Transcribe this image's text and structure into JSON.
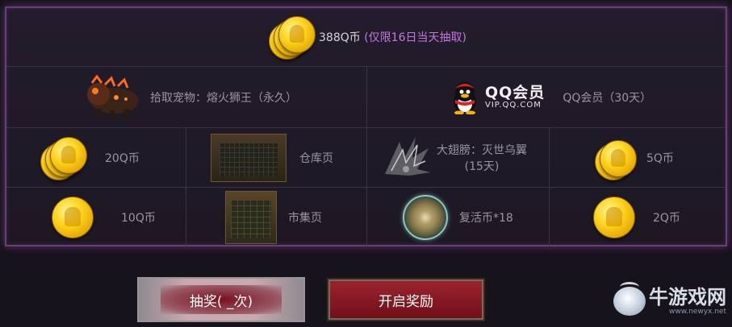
{
  "header": {
    "amount_text": "388Q币",
    "note_text": "(仅限16日当天抽取)"
  },
  "rewards": {
    "row1": [
      {
        "icon": "lion-pet-icon",
        "label": "拾取宠物：熔火狮王（永久）"
      },
      {
        "icon": "qq-vip-logo",
        "logo_title": "QQ会员",
        "logo_sub": "VIP.QQ.COM",
        "label": "QQ会员（30天）"
      }
    ],
    "row2": [
      {
        "icon": "coin-stack-icon",
        "label": "20Q币"
      },
      {
        "icon": "warehouse-page-icon",
        "label": "仓库页"
      },
      {
        "icon": "wings-icon",
        "label_line1": "大翅膀：灭世乌翼",
        "label_line2": "(15天)"
      },
      {
        "icon": "coin-stack-icon",
        "label": "5Q币"
      }
    ],
    "row3": [
      {
        "icon": "coin-icon",
        "label": "10Q币"
      },
      {
        "icon": "market-page-icon",
        "label": "市集页"
      },
      {
        "icon": "revive-coin-icon",
        "label": "复活币*18"
      },
      {
        "icon": "coin-icon",
        "label": "2Q币"
      }
    ]
  },
  "buttons": {
    "draw_label": "抽奖( _次)",
    "open_label": "开启奖励"
  },
  "watermark": {
    "title": "牛游戏网",
    "url": "www.newyx.net"
  },
  "colors": {
    "border_glow": "#6a3f78",
    "note_purple": "#c776e0",
    "open_button": "#9c2430",
    "coin_gold": "#ffd21c"
  }
}
